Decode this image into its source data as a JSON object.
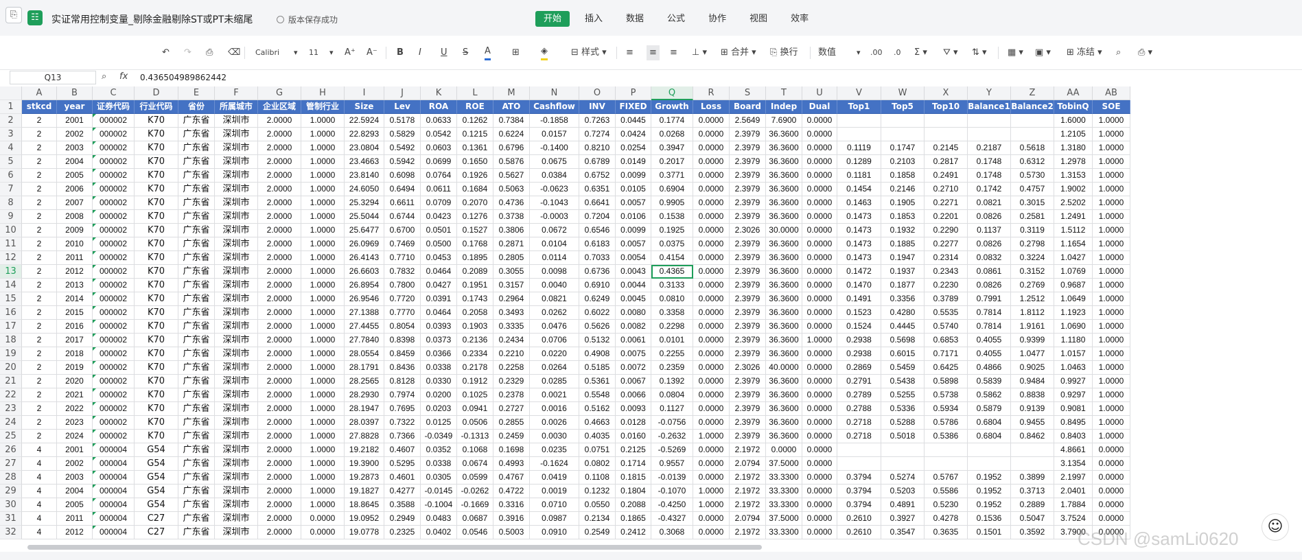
{
  "titlebar": {
    "save_icon": "save-icon",
    "app_icon_glyph": "☷",
    "title": "实证常用控制变量_剔除金融剔除ST或PT未缩尾",
    "status": "版本保存成功"
  },
  "menu": [
    "开始",
    "插入",
    "数据",
    "公式",
    "协作",
    "视图",
    "效率"
  ],
  "menu_active": "开始",
  "toolbar": {
    "undo": "↶",
    "redo": "↷",
    "format_painter": "⎙",
    "eraser": "⌫",
    "font_name": "Calibri",
    "font_size": "11",
    "font_grow": "A⁺",
    "font_shrink": "A⁻",
    "bold": "B",
    "italic": "I",
    "underline": "U",
    "strike": "S",
    "font_color": "A",
    "border": "⊞",
    "fill": "◈",
    "style_label": "样式",
    "merge_label": "合并",
    "wrap_label": "换行",
    "number_format": "数值",
    "sum": "Σ",
    "filter": "⛛",
    "sort": "⇅",
    "chart": "▦",
    "image": "▣",
    "freeze_label": "冻结",
    "find": "⌕",
    "print": "⎙"
  },
  "formula_bar": {
    "name_box": "Q13",
    "fx": "fx",
    "value": "0.436504989862442"
  },
  "grid": {
    "columns": [
      "A",
      "B",
      "C",
      "D",
      "E",
      "F",
      "G",
      "H",
      "I",
      "J",
      "K",
      "L",
      "M",
      "N",
      "O",
      "P",
      "Q",
      "R",
      "S",
      "T",
      "U",
      "V",
      "W",
      "X",
      "Y",
      "Z",
      "AA",
      "AB"
    ],
    "selected_column": "Q",
    "selected_row": "13",
    "header": [
      "stkcd",
      "year",
      "证券代码",
      "行业代码",
      "省份",
      "所属城市",
      "企业区域",
      "管制行业",
      "Size",
      "Lev",
      "ROA",
      "ROE",
      "ATO",
      "Cashflow",
      "INV",
      "FIXED",
      "Growth",
      "Loss",
      "Board",
      "Indep",
      "Dual",
      "Top1",
      "Top5",
      "Top10",
      "Balance1",
      "Balance2",
      "TobinQ",
      "SOE"
    ],
    "rows": [
      [
        "2",
        "2001",
        "000002",
        "K70",
        "广东省",
        "深圳市",
        "2.0000",
        "1.0000",
        "22.5924",
        "0.5178",
        "0.0633",
        "0.1262",
        "0.7384",
        "-0.1858",
        "0.7263",
        "0.0445",
        "0.1774",
        "0.0000",
        "2.5649",
        "7.6900",
        "0.0000",
        "",
        "",
        "",
        "",
        "",
        "1.6000",
        "1.0000"
      ],
      [
        "2",
        "2002",
        "000002",
        "K70",
        "广东省",
        "深圳市",
        "2.0000",
        "1.0000",
        "22.8293",
        "0.5829",
        "0.0542",
        "0.1215",
        "0.6224",
        "0.0157",
        "0.7274",
        "0.0424",
        "0.0268",
        "0.0000",
        "2.3979",
        "36.3600",
        "0.0000",
        "",
        "",
        "",
        "",
        "",
        "1.2105",
        "1.0000"
      ],
      [
        "2",
        "2003",
        "000002",
        "K70",
        "广东省",
        "深圳市",
        "2.0000",
        "1.0000",
        "23.0804",
        "0.5492",
        "0.0603",
        "0.1361",
        "0.6796",
        "-0.1400",
        "0.8210",
        "0.0254",
        "0.3947",
        "0.0000",
        "2.3979",
        "36.3600",
        "0.0000",
        "0.1119",
        "0.1747",
        "0.2145",
        "0.2187",
        "0.5618",
        "1.3180",
        "1.0000"
      ],
      [
        "2",
        "2004",
        "000002",
        "K70",
        "广东省",
        "深圳市",
        "2.0000",
        "1.0000",
        "23.4663",
        "0.5942",
        "0.0699",
        "0.1650",
        "0.5876",
        "0.0675",
        "0.6789",
        "0.0149",
        "0.2017",
        "0.0000",
        "2.3979",
        "36.3600",
        "0.0000",
        "0.1289",
        "0.2103",
        "0.2817",
        "0.1748",
        "0.6312",
        "1.2978",
        "1.0000"
      ],
      [
        "2",
        "2005",
        "000002",
        "K70",
        "广东省",
        "深圳市",
        "2.0000",
        "1.0000",
        "23.8140",
        "0.6098",
        "0.0764",
        "0.1926",
        "0.5627",
        "0.0384",
        "0.6752",
        "0.0099",
        "0.3771",
        "0.0000",
        "2.3979",
        "36.3600",
        "0.0000",
        "0.1181",
        "0.1858",
        "0.2491",
        "0.1748",
        "0.5730",
        "1.3153",
        "1.0000"
      ],
      [
        "2",
        "2006",
        "000002",
        "K70",
        "广东省",
        "深圳市",
        "2.0000",
        "1.0000",
        "24.6050",
        "0.6494",
        "0.0611",
        "0.1684",
        "0.5063",
        "-0.0623",
        "0.6351",
        "0.0105",
        "0.6904",
        "0.0000",
        "2.3979",
        "36.3600",
        "0.0000",
        "0.1454",
        "0.2146",
        "0.2710",
        "0.1742",
        "0.4757",
        "1.9002",
        "1.0000"
      ],
      [
        "2",
        "2007",
        "000002",
        "K70",
        "广东省",
        "深圳市",
        "2.0000",
        "1.0000",
        "25.3294",
        "0.6611",
        "0.0709",
        "0.2070",
        "0.4736",
        "-0.1043",
        "0.6641",
        "0.0057",
        "0.9905",
        "0.0000",
        "2.3979",
        "36.3600",
        "0.0000",
        "0.1463",
        "0.1905",
        "0.2271",
        "0.0821",
        "0.3015",
        "2.5202",
        "1.0000"
      ],
      [
        "2",
        "2008",
        "000002",
        "K70",
        "广东省",
        "深圳市",
        "2.0000",
        "1.0000",
        "25.5044",
        "0.6744",
        "0.0423",
        "0.1276",
        "0.3738",
        "-0.0003",
        "0.7204",
        "0.0106",
        "0.1538",
        "0.0000",
        "2.3979",
        "36.3600",
        "0.0000",
        "0.1473",
        "0.1853",
        "0.2201",
        "0.0826",
        "0.2581",
        "1.2491",
        "1.0000"
      ],
      [
        "2",
        "2009",
        "000002",
        "K70",
        "广东省",
        "深圳市",
        "2.0000",
        "1.0000",
        "25.6477",
        "0.6700",
        "0.0501",
        "0.1527",
        "0.3806",
        "0.0672",
        "0.6546",
        "0.0099",
        "0.1925",
        "0.0000",
        "2.3026",
        "30.0000",
        "0.0000",
        "0.1473",
        "0.1932",
        "0.2290",
        "0.1137",
        "0.3119",
        "1.5112",
        "1.0000"
      ],
      [
        "2",
        "2010",
        "000002",
        "K70",
        "广东省",
        "深圳市",
        "2.0000",
        "1.0000",
        "26.0969",
        "0.7469",
        "0.0500",
        "0.1768",
        "0.2871",
        "0.0104",
        "0.6183",
        "0.0057",
        "0.0375",
        "0.0000",
        "2.3979",
        "36.3600",
        "0.0000",
        "0.1473",
        "0.1885",
        "0.2277",
        "0.0826",
        "0.2798",
        "1.1654",
        "1.0000"
      ],
      [
        "2",
        "2011",
        "000002",
        "K70",
        "广东省",
        "深圳市",
        "2.0000",
        "1.0000",
        "26.4143",
        "0.7710",
        "0.0453",
        "0.1895",
        "0.2805",
        "0.0114",
        "0.7033",
        "0.0054",
        "0.4154",
        "0.0000",
        "2.3979",
        "36.3600",
        "0.0000",
        "0.1473",
        "0.1947",
        "0.2314",
        "0.0832",
        "0.3224",
        "1.0427",
        "1.0000"
      ],
      [
        "2",
        "2012",
        "000002",
        "K70",
        "广东省",
        "深圳市",
        "2.0000",
        "1.0000",
        "26.6603",
        "0.7832",
        "0.0464",
        "0.2089",
        "0.3055",
        "0.0098",
        "0.6736",
        "0.0043",
        "0.4365",
        "0.0000",
        "2.3979",
        "36.3600",
        "0.0000",
        "0.1472",
        "0.1937",
        "0.2343",
        "0.0861",
        "0.3152",
        "1.0769",
        "1.0000"
      ],
      [
        "2",
        "2013",
        "000002",
        "K70",
        "广东省",
        "深圳市",
        "2.0000",
        "1.0000",
        "26.8954",
        "0.7800",
        "0.0427",
        "0.1951",
        "0.3157",
        "0.0040",
        "0.6910",
        "0.0044",
        "0.3133",
        "0.0000",
        "2.3979",
        "36.3600",
        "0.0000",
        "0.1470",
        "0.1877",
        "0.2230",
        "0.0826",
        "0.2769",
        "0.9687",
        "1.0000"
      ],
      [
        "2",
        "2014",
        "000002",
        "K70",
        "广东省",
        "深圳市",
        "2.0000",
        "1.0000",
        "26.9546",
        "0.7720",
        "0.0391",
        "0.1743",
        "0.2964",
        "0.0821",
        "0.6249",
        "0.0045",
        "0.0810",
        "0.0000",
        "2.3979",
        "36.3600",
        "0.0000",
        "0.1491",
        "0.3356",
        "0.3789",
        "0.7991",
        "1.2512",
        "1.0649",
        "1.0000"
      ],
      [
        "2",
        "2015",
        "000002",
        "K70",
        "广东省",
        "深圳市",
        "2.0000",
        "1.0000",
        "27.1388",
        "0.7770",
        "0.0464",
        "0.2058",
        "0.3493",
        "0.0262",
        "0.6022",
        "0.0080",
        "0.3358",
        "0.0000",
        "2.3979",
        "36.3600",
        "0.0000",
        "0.1523",
        "0.4280",
        "0.5535",
        "0.7814",
        "1.8112",
        "1.1923",
        "1.0000"
      ],
      [
        "2",
        "2016",
        "000002",
        "K70",
        "广东省",
        "深圳市",
        "2.0000",
        "1.0000",
        "27.4455",
        "0.8054",
        "0.0393",
        "0.1903",
        "0.3335",
        "0.0476",
        "0.5626",
        "0.0082",
        "0.2298",
        "0.0000",
        "2.3979",
        "36.3600",
        "0.0000",
        "0.1524",
        "0.4445",
        "0.5740",
        "0.7814",
        "1.9161",
        "1.0690",
        "1.0000"
      ],
      [
        "2",
        "2017",
        "000002",
        "K70",
        "广东省",
        "深圳市",
        "2.0000",
        "1.0000",
        "27.7840",
        "0.8398",
        "0.0373",
        "0.2136",
        "0.2434",
        "0.0706",
        "0.5132",
        "0.0061",
        "0.0101",
        "0.0000",
        "2.3979",
        "36.3600",
        "1.0000",
        "0.2938",
        "0.5698",
        "0.6853",
        "0.4055",
        "0.9399",
        "1.1180",
        "1.0000"
      ],
      [
        "2",
        "2018",
        "000002",
        "K70",
        "广东省",
        "深圳市",
        "2.0000",
        "1.0000",
        "28.0554",
        "0.8459",
        "0.0366",
        "0.2334",
        "0.2210",
        "0.0220",
        "0.4908",
        "0.0075",
        "0.2255",
        "0.0000",
        "2.3979",
        "36.3600",
        "0.0000",
        "0.2938",
        "0.6015",
        "0.7171",
        "0.4055",
        "1.0477",
        "1.0157",
        "1.0000"
      ],
      [
        "2",
        "2019",
        "000002",
        "K70",
        "广东省",
        "深圳市",
        "2.0000",
        "1.0000",
        "28.1791",
        "0.8436",
        "0.0338",
        "0.2178",
        "0.2258",
        "0.0264",
        "0.5185",
        "0.0072",
        "0.2359",
        "0.0000",
        "2.3026",
        "40.0000",
        "0.0000",
        "0.2869",
        "0.5459",
        "0.6425",
        "0.4866",
        "0.9025",
        "1.0463",
        "1.0000"
      ],
      [
        "2",
        "2020",
        "000002",
        "K70",
        "广东省",
        "深圳市",
        "2.0000",
        "1.0000",
        "28.2565",
        "0.8128",
        "0.0330",
        "0.1912",
        "0.2329",
        "0.0285",
        "0.5361",
        "0.0067",
        "0.1392",
        "0.0000",
        "2.3979",
        "36.3600",
        "0.0000",
        "0.2791",
        "0.5438",
        "0.5898",
        "0.5839",
        "0.9484",
        "0.9927",
        "1.0000"
      ],
      [
        "2",
        "2021",
        "000002",
        "K70",
        "广东省",
        "深圳市",
        "2.0000",
        "1.0000",
        "28.2930",
        "0.7974",
        "0.0200",
        "0.1025",
        "0.2378",
        "0.0021",
        "0.5548",
        "0.0066",
        "0.0804",
        "0.0000",
        "2.3979",
        "36.3600",
        "0.0000",
        "0.2789",
        "0.5255",
        "0.5738",
        "0.5862",
        "0.8838",
        "0.9297",
        "1.0000"
      ],
      [
        "2",
        "2022",
        "000002",
        "K70",
        "广东省",
        "深圳市",
        "2.0000",
        "1.0000",
        "28.1947",
        "0.7695",
        "0.0203",
        "0.0941",
        "0.2727",
        "0.0016",
        "0.5162",
        "0.0093",
        "0.1127",
        "0.0000",
        "2.3979",
        "36.3600",
        "0.0000",
        "0.2788",
        "0.5336",
        "0.5934",
        "0.5879",
        "0.9139",
        "0.9081",
        "1.0000"
      ],
      [
        "2",
        "2023",
        "000002",
        "K70",
        "广东省",
        "深圳市",
        "2.0000",
        "1.0000",
        "28.0397",
        "0.7322",
        "0.0125",
        "0.0506",
        "0.2855",
        "0.0026",
        "0.4663",
        "0.0128",
        "-0.0756",
        "0.0000",
        "2.3979",
        "36.3600",
        "0.0000",
        "0.2718",
        "0.5288",
        "0.5786",
        "0.6804",
        "0.9455",
        "0.8495",
        "1.0000"
      ],
      [
        "2",
        "2024",
        "000002",
        "K70",
        "广东省",
        "深圳市",
        "2.0000",
        "1.0000",
        "27.8828",
        "0.7366",
        "-0.0349",
        "-0.1313",
        "0.2459",
        "0.0030",
        "0.4035",
        "0.0160",
        "-0.2632",
        "1.0000",
        "2.3979",
        "36.3600",
        "0.0000",
        "0.2718",
        "0.5018",
        "0.5386",
        "0.6804",
        "0.8462",
        "0.8403",
        "1.0000"
      ],
      [
        "4",
        "2001",
        "000004",
        "G54",
        "广东省",
        "深圳市",
        "2.0000",
        "1.0000",
        "19.2182",
        "0.4607",
        "0.0352",
        "0.1068",
        "0.1698",
        "0.0235",
        "0.0751",
        "0.2125",
        "-0.5269",
        "0.0000",
        "2.1972",
        "0.0000",
        "0.0000",
        "",
        "",
        "",
        "",
        "",
        "4.8661",
        "0.0000"
      ],
      [
        "4",
        "2002",
        "000004",
        "G54",
        "广东省",
        "深圳市",
        "2.0000",
        "1.0000",
        "19.3900",
        "0.5295",
        "0.0338",
        "0.0674",
        "0.4993",
        "-0.1624",
        "0.0802",
        "0.1714",
        "0.9557",
        "0.0000",
        "2.0794",
        "37.5000",
        "0.0000",
        "",
        "",
        "",
        "",
        "",
        "3.1354",
        "0.0000"
      ],
      [
        "4",
        "2003",
        "000004",
        "G54",
        "广东省",
        "深圳市",
        "2.0000",
        "1.0000",
        "19.2873",
        "0.4601",
        "0.0305",
        "0.0599",
        "0.4767",
        "0.0419",
        "0.1108",
        "0.1815",
        "-0.0139",
        "0.0000",
        "2.1972",
        "33.3300",
        "0.0000",
        "0.3794",
        "0.5274",
        "0.5767",
        "0.1952",
        "0.3899",
        "2.1997",
        "0.0000"
      ],
      [
        "4",
        "2004",
        "000004",
        "G54",
        "广东省",
        "深圳市",
        "2.0000",
        "1.0000",
        "19.1827",
        "0.4277",
        "-0.0145",
        "-0.0262",
        "0.4722",
        "0.0019",
        "0.1232",
        "0.1804",
        "-0.1070",
        "1.0000",
        "2.1972",
        "33.3300",
        "0.0000",
        "0.3794",
        "0.5203",
        "0.5586",
        "0.1952",
        "0.3713",
        "2.0401",
        "0.0000"
      ],
      [
        "4",
        "2005",
        "000004",
        "G54",
        "广东省",
        "深圳市",
        "2.0000",
        "1.0000",
        "18.8645",
        "0.3588",
        "-0.1004",
        "-0.1669",
        "0.3316",
        "0.0710",
        "0.0550",
        "0.2088",
        "-0.4250",
        "1.0000",
        "2.1972",
        "33.3300",
        "0.0000",
        "0.3794",
        "0.4891",
        "0.5230",
        "0.1952",
        "0.2889",
        "1.7884",
        "0.0000"
      ],
      [
        "4",
        "2011",
        "000004",
        "C27",
        "广东省",
        "深圳市",
        "2.0000",
        "0.0000",
        "19.0952",
        "0.2949",
        "0.0483",
        "0.0687",
        "0.3916",
        "0.0987",
        "0.2134",
        "0.1865",
        "-0.4327",
        "0.0000",
        "2.0794",
        "37.5000",
        "0.0000",
        "0.2610",
        "0.3927",
        "0.4278",
        "0.1536",
        "0.5047",
        "3.7524",
        "0.0000"
      ],
      [
        "4",
        "2012",
        "000004",
        "C27",
        "广东省",
        "深圳市",
        "2.0000",
        "0.0000",
        "19.0778",
        "0.2325",
        "0.0402",
        "0.0546",
        "0.5003",
        "0.0910",
        "0.2549",
        "0.2412",
        "0.3068",
        "0.0000",
        "2.1972",
        "33.3300",
        "0.0000",
        "0.2610",
        "0.3547",
        "0.3635",
        "0.1501",
        "0.3592",
        "3.7900",
        "0.0000"
      ]
    ]
  },
  "watermark": "CSDN @samLi0620",
  "avatar_glyph": "☺"
}
